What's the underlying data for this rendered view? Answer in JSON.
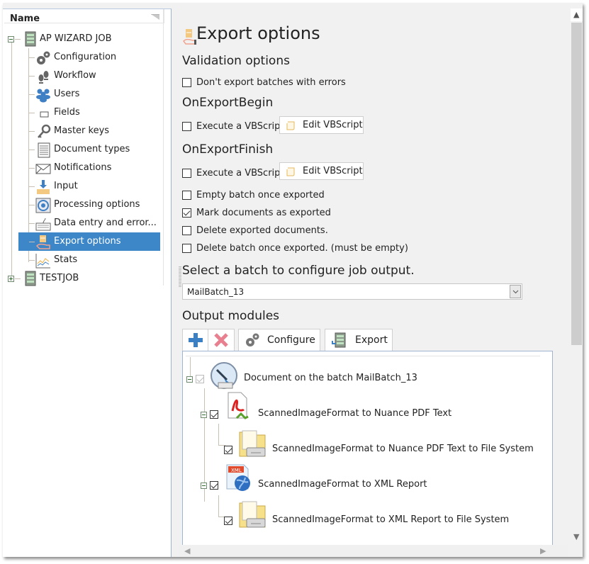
{
  "sidebar": {
    "column_header": "Name",
    "tree": [
      {
        "label": "AP WIZARD JOB",
        "icon": "server-icon",
        "expanded": true,
        "children": [
          {
            "label": "Configuration",
            "icon": "gears-icon"
          },
          {
            "label": "Workflow",
            "icon": "footprints-icon"
          },
          {
            "label": "Users",
            "icon": "users-icon"
          },
          {
            "label": "Fields",
            "icon": "field-box-icon"
          },
          {
            "label": "Master keys",
            "icon": "key-icon"
          },
          {
            "label": "Document types",
            "icon": "document-types-icon"
          },
          {
            "label": "Notifications",
            "icon": "envelope-icon"
          },
          {
            "label": "Input",
            "icon": "inbox-download-icon"
          },
          {
            "label": "Processing options",
            "icon": "processing-icon"
          },
          {
            "label": "Data entry and error...",
            "icon": "keyboard-icon"
          },
          {
            "label": "Export options",
            "icon": "export-hand-icon",
            "selected": true
          },
          {
            "label": "Stats",
            "icon": "chart-icon"
          }
        ]
      },
      {
        "label": "TESTJOB",
        "icon": "server-icon",
        "expanded": false
      }
    ]
  },
  "main": {
    "title": "Export options",
    "validation": {
      "heading": "Validation options",
      "dont_export_errors": {
        "label": "Don't export batches with errors",
        "checked": false
      }
    },
    "on_export_begin": {
      "heading": "OnExportBegin",
      "execute": {
        "label": "Execute a VBScript",
        "checked": false
      },
      "edit_button": "Edit VBScript"
    },
    "on_export_finish": {
      "heading": "OnExportFinish",
      "execute": {
        "label": "Execute a VBScript",
        "checked": false
      },
      "edit_button": "Edit VBScript"
    },
    "options": [
      {
        "label": "Empty batch once exported",
        "checked": false
      },
      {
        "label": "Mark documents as exported",
        "checked": true
      },
      {
        "label": "Delete exported documents.",
        "checked": false
      },
      {
        "label": "Delete batch once exported. (must be empty)",
        "checked": false
      }
    ],
    "batch_select": {
      "heading": "Select a batch to configure job output.",
      "value": "MailBatch_13"
    },
    "output_modules": {
      "heading": "Output modules",
      "toolbar": {
        "add_icon": "plus-icon",
        "remove_icon": "x-icon",
        "configure_label": "Configure",
        "export_label": "Export"
      },
      "tree": [
        {
          "label": "Document on the batch MailBatch_13",
          "checked": true,
          "disabled": true,
          "icon": "scanner-icon"
        },
        {
          "label": "ScannedImageFormat to Nuance PDF Text",
          "checked": true,
          "icon": "pdf-convert-icon"
        },
        {
          "label": "ScannedImageFormat to Nuance PDF Text to File System",
          "checked": true,
          "icon": "folder-drive-icon"
        },
        {
          "label": "ScannedImageFormat to XML Report",
          "checked": true,
          "icon": "xml-globe-icon"
        },
        {
          "label": "ScannedImageFormat to XML Report to File System",
          "checked": true,
          "icon": "folder-drive-icon"
        }
      ]
    }
  },
  "colors": {
    "selection": "#3d87c8",
    "panel_bg": "#f1f1f1",
    "add_blue": "#3b7fc4",
    "remove_red": "#e9808f"
  }
}
